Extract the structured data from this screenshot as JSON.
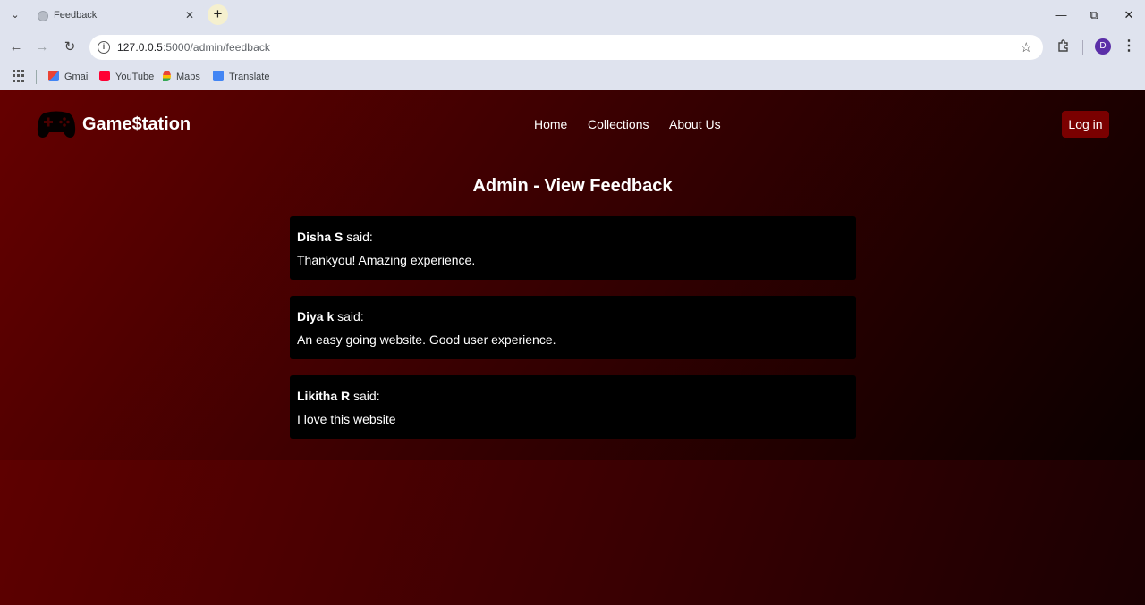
{
  "browser": {
    "tab_title": "Feedback",
    "url_host": "127.0.0.5",
    "url_path": ":5000/admin/feedback",
    "profile_initial": "D",
    "bookmarks": [
      "Gmail",
      "YouTube",
      "Maps",
      "Translate"
    ]
  },
  "site": {
    "brand": "Game$tation",
    "nav": [
      "Home",
      "Collections",
      "About Us"
    ],
    "login_label": "Log in"
  },
  "main": {
    "title": "Admin - View Feedback",
    "feedback": [
      {
        "name": "Disha S",
        "said": "said:",
        "message": "Thankyou! Amazing experience."
      },
      {
        "name": "Diya k",
        "said": "said:",
        "message": "An easy going website. Good user experience."
      },
      {
        "name": "Likitha R",
        "said": "said:",
        "message": "I love this website"
      }
    ]
  },
  "colors": {
    "accent": "#7a0000",
    "card_bg": "#000000",
    "page_gradient_start": "#6a0000",
    "page_gradient_end": "#0e0001"
  }
}
